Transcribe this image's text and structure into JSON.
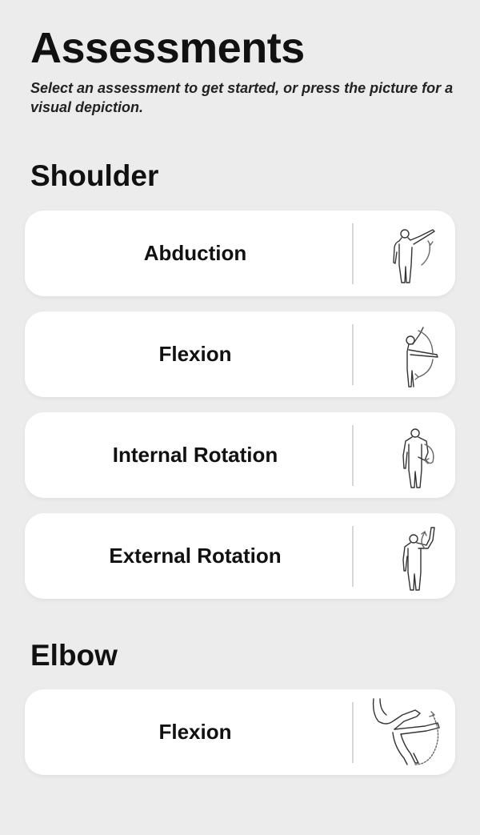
{
  "header": {
    "title": "Assessments",
    "subtitle": "Select an assessment to get started, or press the picture for a visual depiction."
  },
  "sections": [
    {
      "title": "Shoulder",
      "items": [
        {
          "label": "Abduction",
          "icon": "shoulder-abduction-figure-icon"
        },
        {
          "label": "Flexion",
          "icon": "shoulder-flexion-figure-icon"
        },
        {
          "label": "Internal Rotation",
          "icon": "internal-rotation-figure-icon"
        },
        {
          "label": "External Rotation",
          "icon": "external-rotation-figure-icon"
        }
      ]
    },
    {
      "title": "Elbow",
      "items": [
        {
          "label": "Flexion",
          "icon": "elbow-flexion-figure-icon"
        }
      ]
    }
  ],
  "colors": {
    "background": "#ececec",
    "card": "#ffffff",
    "text": "#111111",
    "divider": "#d6d6d6"
  }
}
